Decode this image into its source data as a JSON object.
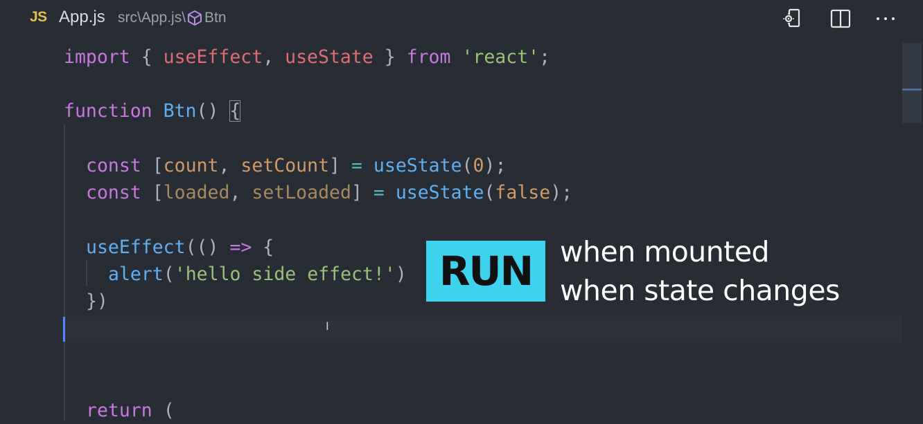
{
  "tab": {
    "badge": "JS",
    "title": "App.js",
    "path": "src\\App.js\\",
    "symbol": "Btn"
  },
  "toolbar": {
    "icons": [
      "open-changes-icon",
      "split-editor-icon",
      "more-actions-icon"
    ]
  },
  "code": {
    "l1": {
      "kw1": "import",
      "p1": " { ",
      "v1": "useEffect",
      "p2": ", ",
      "v2": "useState",
      "p3": " } ",
      "kw2": "from",
      "sp": " ",
      "s1": "'react'",
      "p4": ";"
    },
    "l2": {
      "kw": "function",
      "sp": " ",
      "fn": "Btn",
      "p1": "() ",
      "br": "{"
    },
    "l3": {
      "kw": "const",
      "p1": " [",
      "a": "count",
      "p2": ", ",
      "b": "setCount",
      "p3": "] ",
      "op": "=",
      "sp": " ",
      "fn": "useState",
      "p4": "(",
      "n": "0",
      "p5": ");"
    },
    "l4": {
      "kw": "const",
      "p1": " [",
      "a": "loaded",
      "p2": ", ",
      "b": "setLoaded",
      "p3": "] ",
      "op": "=",
      "sp": " ",
      "fn": "useState",
      "p4": "(",
      "n": "false",
      "p5": ");"
    },
    "l5": {
      "fn": "useEffect",
      "p1": "(() ",
      "op": "=>",
      "p2": " {"
    },
    "l6": {
      "fn": "alert",
      "p1": "(",
      "s": "'hello side effect!'",
      "p2": ")"
    },
    "l7": {
      "p": "})"
    },
    "l8": {
      "kw": "return",
      "p": " ("
    }
  },
  "overlay": {
    "badge": "RUN",
    "line1": "when mounted",
    "line2": "when state changes",
    "badge_color": "#3fd2ee"
  },
  "colors": {
    "background": "#282c34",
    "keyword": "#c678dd",
    "variable": "#e06c75",
    "string": "#98c379",
    "function": "#61afef",
    "number": "#d19a66",
    "cursor": "#528bff"
  }
}
